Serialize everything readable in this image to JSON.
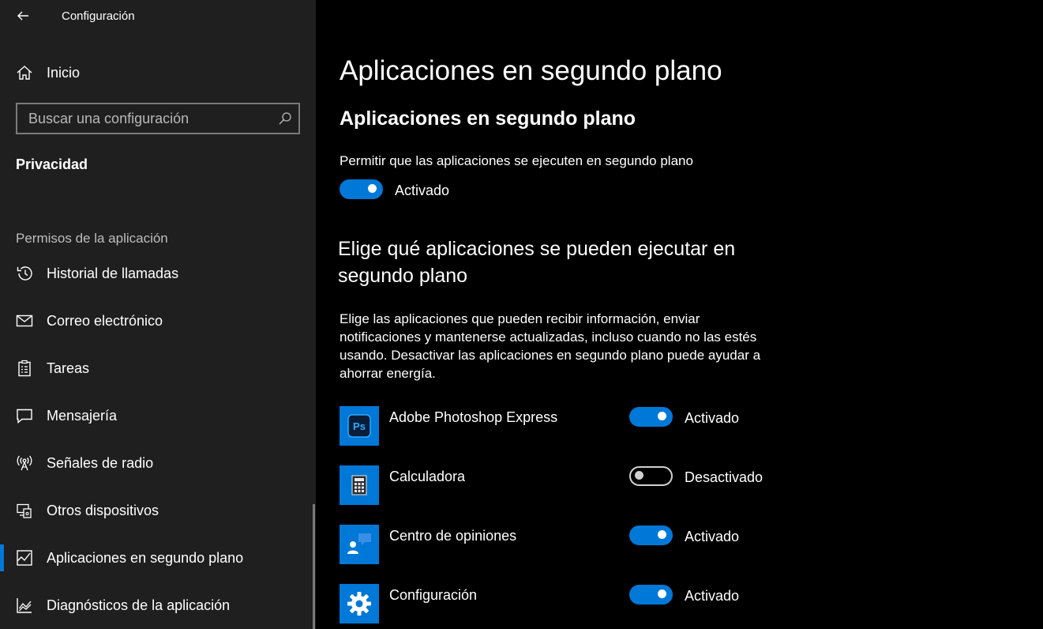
{
  "window": {
    "title": "Configuración",
    "back_icon": "back-arrow-icon"
  },
  "sidebar": {
    "home": {
      "label": "Inicio",
      "icon": "home-icon"
    },
    "search": {
      "placeholder": "Buscar una configuración",
      "value": "",
      "icon": "search-icon"
    },
    "section_title": "Privacidad",
    "group_header": "Permisos de la aplicación",
    "items": [
      {
        "label": "Historial de llamadas",
        "icon": "call-history-icon"
      },
      {
        "label": "Correo electrónico",
        "icon": "mail-icon"
      },
      {
        "label": "Tareas",
        "icon": "tasks-clipboard-icon"
      },
      {
        "label": "Mensajería",
        "icon": "messaging-icon"
      },
      {
        "label": "Señales de radio",
        "icon": "radio-signal-icon"
      },
      {
        "label": "Otros dispositivos",
        "icon": "other-devices-icon"
      },
      {
        "label": "Aplicaciones en segundo plano",
        "icon": "background-apps-icon",
        "selected": true
      },
      {
        "label": "Diagnósticos de la aplicación",
        "icon": "diagnostics-icon"
      }
    ]
  },
  "main": {
    "page_title": "Aplicaciones en segundo plano",
    "subtitle": "Aplicaciones en segundo plano",
    "allow_label": "Permitir que las aplicaciones se ejecuten en segundo plano",
    "allow_toggle": {
      "state": "on",
      "label": "Activado"
    },
    "choose_title": "Elige qué aplicaciones se pueden ejecutar en segundo plano",
    "description": "Elige las aplicaciones que pueden recibir información, enviar notificaciones y mantenerse actualizadas, incluso cuando no las estés usando. Desactivar las aplicaciones en segundo plano puede ayudar a ahorrar energía.",
    "apps": [
      {
        "name": "Adobe Photoshop Express",
        "icon": "photoshop-express-icon",
        "state": "on",
        "status": "Activado"
      },
      {
        "name": "Calculadora",
        "icon": "calculator-icon",
        "state": "off",
        "status": "Desactivado"
      },
      {
        "name": "Centro de opiniones",
        "icon": "feedback-hub-icon",
        "state": "on",
        "status": "Activado"
      },
      {
        "name": "Configuración",
        "icon": "settings-gear-icon",
        "state": "on",
        "status": "Activado"
      }
    ]
  },
  "colors": {
    "accent": "#0078d7",
    "sidebar_bg": "#1f1f1f",
    "main_bg": "#000000"
  }
}
